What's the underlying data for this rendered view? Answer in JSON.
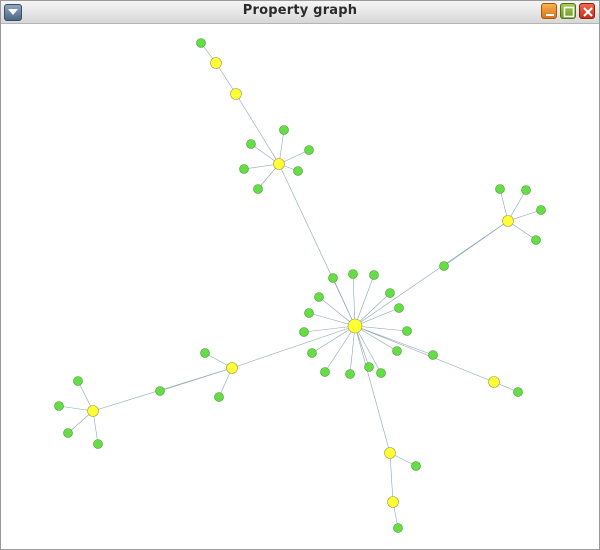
{
  "window": {
    "title": "Property graph",
    "menu_icon": "chevron-down-icon",
    "minimize_icon": "minimize-icon",
    "maximize_icon": "maximize-icon",
    "close_icon": "close-icon"
  },
  "colors": {
    "hub_node": "#ffff33",
    "leaf_node": "#66dd44",
    "edge": "#8aa7b3"
  },
  "graph": {
    "node_types": [
      "hub",
      "leaf"
    ]
  }
}
